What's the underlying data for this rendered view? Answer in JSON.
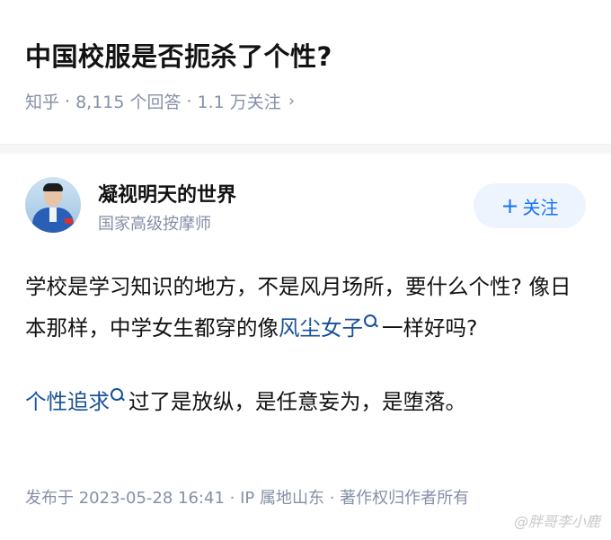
{
  "question": {
    "title": "中国校服是否扼杀了个性?",
    "source": "知乎",
    "answers_count": "8,115 个回答",
    "followers": "1.1 万关注",
    "chevron": "›"
  },
  "author": {
    "name": "凝视明天的世界",
    "bio": "国家高级按摩师",
    "follow_plus": "+",
    "follow_label": "关注"
  },
  "answer": {
    "p1_text1": "学校是学习知识的地方，不是风月场所，要什么个性? 像日本那样，中学女生都穿的像",
    "p1_keyword": "风尘女子",
    "p1_text2": "一样好吗?",
    "p2_keyword": "个性追求",
    "p2_text": "过了是放纵，是任意妄为，是堕落。"
  },
  "footer": "发布于 2023-05-28 16:41 · IP 属地山东 · 著作权归作者所有",
  "watermark": "@胖哥李小鹿",
  "colors": {
    "link": "#175199",
    "accent": "#1772f6",
    "meta": "#8590a6"
  },
  "icons": {
    "keyword_search": "search-icon"
  }
}
